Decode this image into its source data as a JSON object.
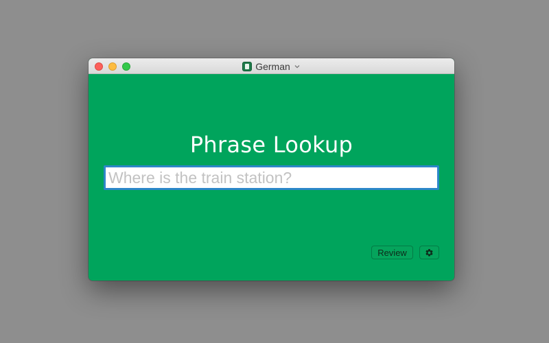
{
  "window": {
    "title": "German",
    "icon": "flashcard-app-icon",
    "controls": [
      "close",
      "minimize",
      "zoom"
    ]
  },
  "main": {
    "heading": "Phrase Lookup",
    "search": {
      "value": "",
      "placeholder": "Where is the train station?"
    },
    "review_label": "Review",
    "settings_icon": "gear-icon"
  },
  "colors": {
    "background": "#00a45c",
    "input_focus_border": "#2c87c9",
    "desktop": "#8e8e8e"
  }
}
